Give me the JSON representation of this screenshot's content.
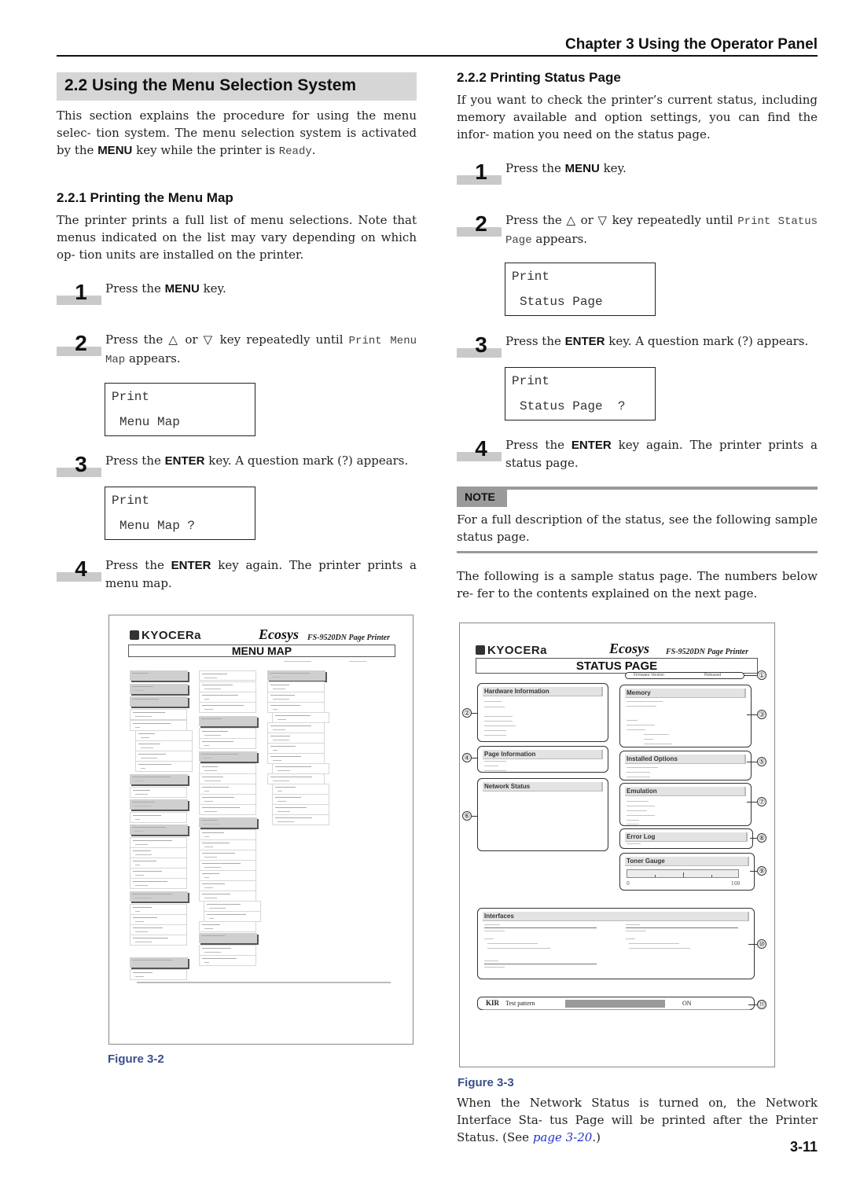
{
  "header": {
    "chapter_title": "Chapter 3  Using the Operator Panel"
  },
  "section": {
    "title": "2.2 Using the Menu Selection System",
    "intro_pre": "This section explains the procedure for using the menu selec- tion system. The menu selection system is activated by the ",
    "intro_key": "MENU",
    "intro_mid": " key while the printer is ",
    "intro_state": "Ready",
    "intro_post": "."
  },
  "menu_map_section": {
    "title": "2.2.1 Printing the Menu Map",
    "intro": "The printer prints a full list of menu selections. Note that menus indicated on the list may vary depending on which op- tion units are installed on the printer.",
    "steps": [
      {
        "num": "1",
        "pre": "Press the ",
        "key": "MENU",
        "post": " key."
      },
      {
        "num": "2",
        "pre": "Press the △ or ▽ key repeatedly until ",
        "mono": "Print Menu Map",
        "post": " appears."
      },
      {
        "num": "3",
        "pre": "Press the ",
        "key": "ENTER",
        "post": " key. A question mark (?) appears."
      },
      {
        "num": "4",
        "pre": "Press the ",
        "key": "ENTER",
        "post": " key again. The printer prints a menu map."
      }
    ],
    "lcd1": {
      "line1": "Print",
      "line2": "Menu Map"
    },
    "lcd2": {
      "line1": "Print",
      "line2": "Menu Map ?"
    },
    "figure": {
      "caption": "Figure 3-2",
      "brand": "KYOCERa",
      "ecosys": "Ecosys",
      "model": "FS-9520DN  Page Printer",
      "title": "MENU MAP"
    }
  },
  "status_section": {
    "title": "2.2.2 Printing Status Page",
    "intro": "If you want to check the printer’s current status, including memory available and option settings, you can find the infor- mation you need on the status page.",
    "steps": [
      {
        "num": "1",
        "pre": "Press the ",
        "key": "MENU",
        "post": " key."
      },
      {
        "num": "2",
        "pre": "Press the △ or ▽ key repeatedly until ",
        "mono": "Print Status Page",
        "post": " appears."
      },
      {
        "num": "3",
        "pre": "Press the ",
        "key": "ENTER",
        "post": " key. A question mark (?) appears."
      },
      {
        "num": "4",
        "pre": "Press the ",
        "key": "ENTER",
        "post": " key again. The printer prints a status page."
      }
    ],
    "lcd1": {
      "line1": "Print",
      "line2": "Status Page"
    },
    "lcd2": {
      "line1": "Print",
      "line2": "Status Page  ?"
    },
    "note": {
      "label": "NOTE",
      "text": "For a full description of the status, see the following sample status page."
    },
    "sample_intro": "The following is a sample status page. The numbers below re- fer to the contents explained on the next page.",
    "figure": {
      "caption": "Figure 3-3",
      "brand": "KYOCERa",
      "ecosys": "Ecosys",
      "model": "FS-9520DN  Page Printer",
      "title": "STATUS PAGE",
      "firmware_label": "Firmware Version",
      "firmware_value": "Released",
      "panels": {
        "hardware": "Hardware Information",
        "memory": "Memory",
        "page_info": "Page Information",
        "options": "Installed Options",
        "network": "Network Status",
        "emulation": "Emulation",
        "error_log": "Error Log",
        "toner": "Toner Gauge",
        "interfaces": "Interfaces"
      },
      "toner_min": "0",
      "toner_max": "100",
      "kir_label": "KIR",
      "kir_test": "Test pattern",
      "kir_value": "ON",
      "callouts": [
        "①",
        "②",
        "③",
        "④",
        "⑤",
        "⑥",
        "⑦",
        "⑧",
        "⑨",
        "⑩",
        "⑪"
      ]
    },
    "footer_pre": "When the Network Status is turned on, the Network Interface Sta- tus Page will be printed after the Printer Status. (See ",
    "footer_link": "page 3-20",
    "footer_post": ".)"
  },
  "page_number": "3-11"
}
